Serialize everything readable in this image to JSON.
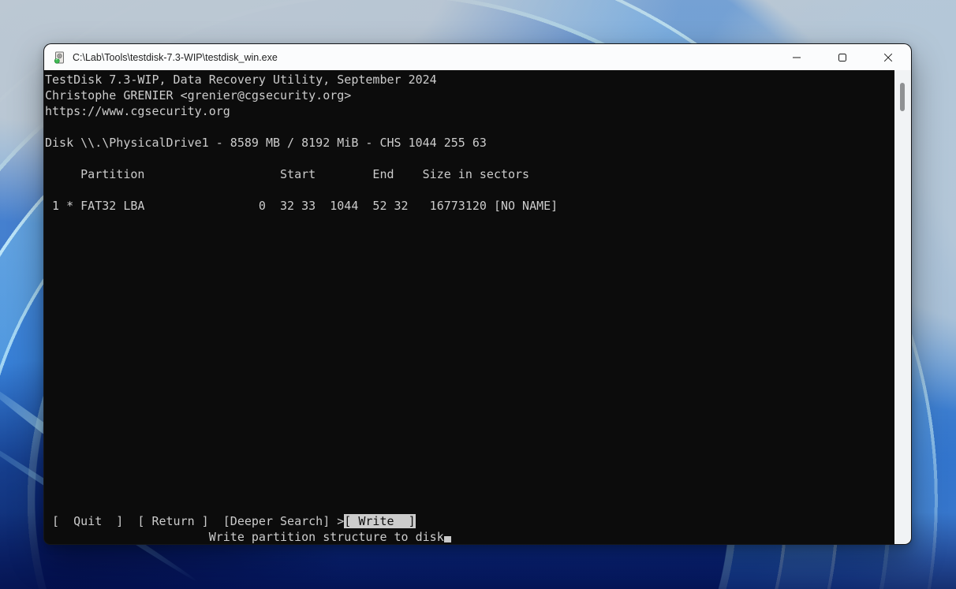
{
  "window": {
    "title": "C:\\Lab\\Tools\\testdisk-7.3-WIP\\testdisk_win.exe",
    "icon": "hard-drive-icon",
    "controls": {
      "minimize": "minimize",
      "maximize": "maximize",
      "close": "close"
    }
  },
  "console": {
    "fg_color": "#cccccc",
    "bg_color": "#0c0c0c",
    "lines": [
      "TestDisk 7.3-WIP, Data Recovery Utility, September 2024",
      "Christophe GRENIER <grenier@cgsecurity.org>",
      "https://www.cgsecurity.org",
      "",
      "Disk \\\\.\\PhysicalDrive1 - 8589 MB / 8192 MiB - CHS 1044 255 63",
      "",
      "     Partition                   Start        End    Size in sectors",
      "",
      " 1 * FAT32 LBA                0  32 33  1044  52 32   16773120 [NO NAME]"
    ],
    "menu": {
      "prefix": " [  Quit  ]  [ Return ]  [Deeper Search] >",
      "selected": "[ Write  ]"
    },
    "status": "                       Write partition structure to disk"
  }
}
